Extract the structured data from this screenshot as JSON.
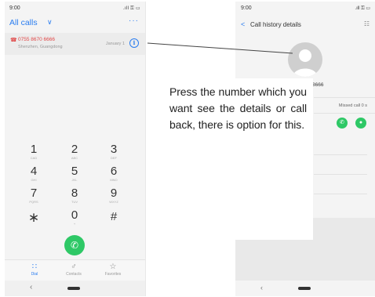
{
  "left_phone": {
    "status": {
      "time": "9:00",
      "signal": ".ıl ☲ ⴾ"
    },
    "header": {
      "title": "All calls",
      "more": "···"
    },
    "call_entry": {
      "number": "0755 8670 6666",
      "location": "Shenzhen, Guangdong",
      "date": "January 1"
    },
    "dialpad": [
      {
        "digit": "1",
        "letters": "CAD"
      },
      {
        "digit": "2",
        "letters": "ABC"
      },
      {
        "digit": "3",
        "letters": "DEF"
      },
      {
        "digit": "4",
        "letters": "GHI"
      },
      {
        "digit": "5",
        "letters": "JKL"
      },
      {
        "digit": "6",
        "letters": "MNO"
      },
      {
        "digit": "7",
        "letters": "PQRS"
      },
      {
        "digit": "8",
        "letters": "TUV"
      },
      {
        "digit": "9",
        "letters": "WXYZ"
      },
      {
        "digit": "∗",
        "letters": ""
      },
      {
        "digit": "0",
        "letters": "+"
      },
      {
        "digit": "#",
        "letters": ""
      }
    ],
    "bottom_nav": [
      {
        "label": "Dial",
        "icon": "dialpad-icon",
        "active": true
      },
      {
        "label": "Contacts",
        "icon": "contacts-icon",
        "active": false
      },
      {
        "label": "Favorites",
        "icon": "star-icon",
        "active": false
      }
    ]
  },
  "right_phone": {
    "status": {
      "time": "9:00",
      "signal": ".ıl ☲ ⴾ"
    },
    "header": {
      "title": "Call history details"
    },
    "number_partial": "8666",
    "missed": "Missed call 0 s"
  },
  "callout": {
    "text": "Press the number which you want see the details or call back, there is option for this."
  },
  "colors": {
    "accent": "#2a7df0",
    "call_green": "#2ec866",
    "missed_red": "#e04646"
  }
}
